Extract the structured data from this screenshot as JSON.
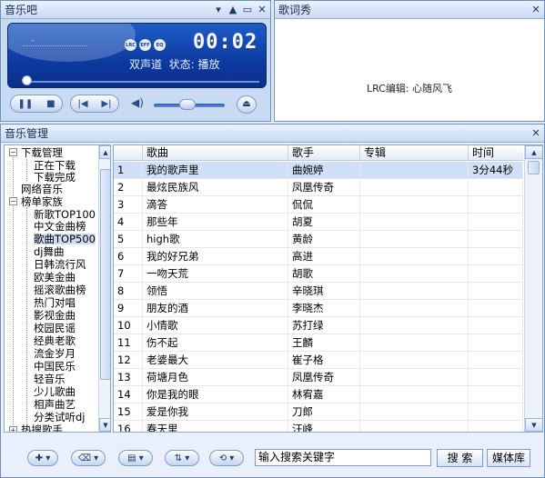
{
  "player": {
    "title": "音乐吧",
    "time": "00:02",
    "channel": "双声道",
    "status_label": "状态:",
    "status_value": "播放",
    "badges": [
      "LRC",
      "EFF",
      "EQ"
    ],
    "progress_fraction": 0.02,
    "volume_fraction": 0.45,
    "icons": [
      "play-pause-icon",
      "stop-icon",
      "prev-icon",
      "next-icon",
      "volume-icon",
      "eject-icon"
    ]
  },
  "lyrics": {
    "title": "歌词秀",
    "lrc_text": "LRC编辑: 心随风飞"
  },
  "manager": {
    "title": "音乐管理",
    "tree": {
      "download": "下载管理",
      "downloading": "正在下载",
      "downloaded": "下载完成",
      "web_music": "网络音乐",
      "charts": "榜单家族",
      "chart_items": [
        "新歌TOP100",
        "中文金曲榜",
        "歌曲TOP500",
        "dj舞曲",
        "日韩流行风",
        "欧美金曲",
        "摇滚歌曲榜",
        "热门对唱",
        "影视金曲",
        "校园民谣",
        "经典老歌",
        "流金岁月",
        "中国民乐",
        "轻音乐",
        "少儿歌曲",
        "相声曲艺",
        "分类试听dj"
      ],
      "hot": "热搜歌手"
    },
    "columns": [
      "歌曲",
      "歌手",
      "专辑",
      "时间"
    ],
    "rows": [
      {
        "n": "1",
        "song": "我的歌声里",
        "artist": "曲婉婷",
        "album": "",
        "time": "3分44秒"
      },
      {
        "n": "2",
        "song": "最炫民族风",
        "artist": "凤凰传奇",
        "album": "",
        "time": ""
      },
      {
        "n": "3",
        "song": "滴答",
        "artist": "侃侃",
        "album": "",
        "time": ""
      },
      {
        "n": "4",
        "song": "那些年",
        "artist": "胡夏",
        "album": "",
        "time": ""
      },
      {
        "n": "5",
        "song": "high歌",
        "artist": "黄龄",
        "album": "",
        "time": ""
      },
      {
        "n": "6",
        "song": "我的好兄弟",
        "artist": "高进",
        "album": "",
        "time": ""
      },
      {
        "n": "7",
        "song": "一吻天荒",
        "artist": "胡歌",
        "album": "",
        "time": ""
      },
      {
        "n": "8",
        "song": "领悟",
        "artist": "辛晓琪",
        "album": "",
        "time": ""
      },
      {
        "n": "9",
        "song": "朋友的酒",
        "artist": "李晓杰",
        "album": "",
        "time": ""
      },
      {
        "n": "10",
        "song": "小情歌",
        "artist": "苏打绿",
        "album": "",
        "time": ""
      },
      {
        "n": "11",
        "song": "伤不起",
        "artist": "王麟",
        "album": "",
        "time": ""
      },
      {
        "n": "12",
        "song": "老婆最大",
        "artist": "崔子格",
        "album": "",
        "time": ""
      },
      {
        "n": "13",
        "song": "荷塘月色",
        "artist": "凤凰传奇",
        "album": "",
        "time": ""
      },
      {
        "n": "14",
        "song": "你是我的眼",
        "artist": "林宥嘉",
        "album": "",
        "time": ""
      },
      {
        "n": "15",
        "song": "爱是你我",
        "artist": "刀郎",
        "album": "",
        "time": ""
      },
      {
        "n": "16",
        "song": "春天里",
        "artist": "汪峰",
        "album": "",
        "time": ""
      }
    ],
    "search_value": "输入搜索关键字",
    "search_button": "搜 索",
    "library_button": "媒体库"
  }
}
